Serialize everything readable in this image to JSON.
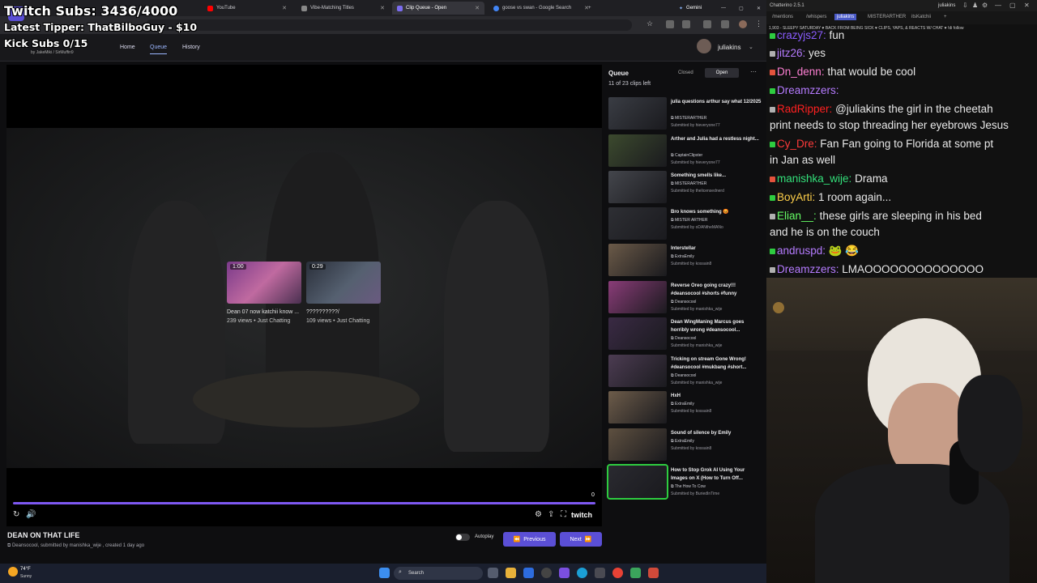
{
  "overlay": {
    "twitch_subs": "Twitch Subs: 3436/4000",
    "latest_tipper": "Latest Tipper: ThatBilboGuy - $10",
    "kick_subs": "Kick Subs 0/15"
  },
  "browser": {
    "tabs": [
      {
        "label": "YouTube",
        "color": "#ff0000"
      },
      {
        "label": "Vibe-Matching Titles",
        "color": "#888888"
      },
      {
        "label": "Clip Queue - Open",
        "color": "#7b6cf0"
      },
      {
        "label": "goose vs swan - Google Search",
        "color": "#4285f4"
      }
    ],
    "gemini_label": "Gemini"
  },
  "site": {
    "nav": {
      "home": "Home",
      "queue": "Queue",
      "history": "History"
    },
    "user": "juliakins",
    "byline": "by JakeMiki / SirMuffin9"
  },
  "player": {
    "endcards": [
      {
        "duration": "1:00",
        "title": "Dean 07 now katchii know ...",
        "meta": "239 views • Just Chatting"
      },
      {
        "duration": "0:29",
        "title": "??????????/",
        "meta": "109 views • Just Chatting"
      }
    ],
    "time_counter": "0",
    "twitch_label": "twitch",
    "progress_fraction": 1.0
  },
  "clip": {
    "title": "DEAN ON THAT LIFE",
    "channel": "Deansocool",
    "meta_suffix": ", submitted by manishka_wije , created 1 day ago",
    "autoplay_label": "Autoplay",
    "previous_label": "Previous",
    "next_label": "Next"
  },
  "queue": {
    "title": "Queue",
    "count": "11 of 23 clips left",
    "closed_label": "Closed",
    "open_label": "Open",
    "items": [
      {
        "title": "julia questions arthur say what 12/2025",
        "channel": "MISTERARTHER",
        "submitter": "Submitted by hieveryone77",
        "thumb": "#3a3d44"
      },
      {
        "title": "Arther and Julia had a restless night...",
        "channel": "CaptainClipster",
        "submitter": "Submitted by hieveryone77",
        "thumb": "#3c4a2e"
      },
      {
        "title": "Something smells like...",
        "channel": "MISTERARTHER",
        "submitter": "Submitted by thelicensednerd",
        "thumb": "#44464c"
      },
      {
        "title": "Bro knows something 😡",
        "channel": "MISTER ARTHER",
        "submitter": "Submitted by oDANtheMANo",
        "thumb": "#2e2f34"
      },
      {
        "title": "Interstellar",
        "channel": "ExtraEmily",
        "submitter": "Submitted by kossain8",
        "thumb": "#6b5a48"
      },
      {
        "title": "Reverse Oreo going crazy!!! #deansocool #shorts #funny",
        "channel": "Deansocool",
        "submitter": "Submitted by manishka_wije",
        "thumb": "#8a3c78"
      },
      {
        "title": "Dean WingManing Marcus goes horribly wrong #deansocool...",
        "channel": "Deansocool",
        "submitter": "Submitted by manishka_wije",
        "thumb": "#3a2a44"
      },
      {
        "title": "Tricking on stream Gone Wrong! #deansocool #mukbang #short...",
        "channel": "Deansocool",
        "submitter": "Submitted by manishka_wije",
        "thumb": "#4c3c52"
      },
      {
        "title": "HxH",
        "channel": "ExtraEmily",
        "submitter": "Submitted by kossain8",
        "thumb": "#6d5c4a"
      },
      {
        "title": "Sound of silence by Emily",
        "channel": "ExtraEmily",
        "submitter": "Submitted by kossain8",
        "thumb": "#5e5040"
      },
      {
        "title": "How to Stop Grok AI Using Your Images on X (How to Turn Off...",
        "channel": "The How To Cow",
        "submitter": "Submitted by BuriedInTime",
        "thumb": "#2a2a30"
      }
    ]
  },
  "chat": {
    "app_title": "Chatterino 2.5.1",
    "channel": "juliakins",
    "tabs": [
      "/mentions",
      "/whispers",
      "juliakins",
      "MISTERARTHER",
      "itsKatchii"
    ],
    "topic": "1,903 - SLEEPY SATURDAY ♥ BACK FROM BEING SICK ♥ CLIPS, YAPS, & REACTS W/ CHAT ♥ !di  follow",
    "messages": [
      {
        "user": "crazyjs27",
        "text": " fun",
        "color": "#8a5cff"
      },
      {
        "user": "jitz26",
        "text": " yes",
        "color": "#b57bff"
      },
      {
        "user": "Dn_denn",
        "text": " that would be cool",
        "color": "#ff80d4"
      },
      {
        "user": "Dreamzzers",
        "text": "",
        "color": "#b57bff"
      },
      {
        "user": "RadRipper",
        "text": " @juliakins the girl in the cheetah",
        "color": "#ff2020"
      },
      {
        "user": "",
        "text": "print needs to stop threading her eyebrows Jesus",
        "color": "#e8e8e8"
      },
      {
        "user": "Cy_Dre",
        "text": " Fan Fan going to Florida at some pt",
        "color": "#ff3a3a"
      },
      {
        "user": "",
        "text": "in Jan as well",
        "color": "#e8e8e8"
      },
      {
        "user": "manishka_wije",
        "text": " Drama",
        "color": "#33e07a"
      },
      {
        "user": "BoyArti",
        "text": " 1 room again...",
        "color": "#ffd04a"
      },
      {
        "user": "Elian__",
        "text": " these girls are sleeping in his bed",
        "color": "#66ff66"
      },
      {
        "user": "",
        "text": "and he is on the couch",
        "color": "#e8e8e8"
      },
      {
        "user": "andruspd",
        "text": " 🐸 😂",
        "color": "#b57bff"
      },
      {
        "user": "Dreamzzers",
        "text": " LMAOOOOOOOOOOOOOO",
        "color": "#b57bff"
      }
    ]
  },
  "taskbar": {
    "temp": "74°F",
    "weather": "Sunny",
    "search": "Search"
  },
  "colors": {
    "accent": "#5b4fd6",
    "progress": "#7e58f2",
    "selected_outline": "#2ecc40"
  }
}
